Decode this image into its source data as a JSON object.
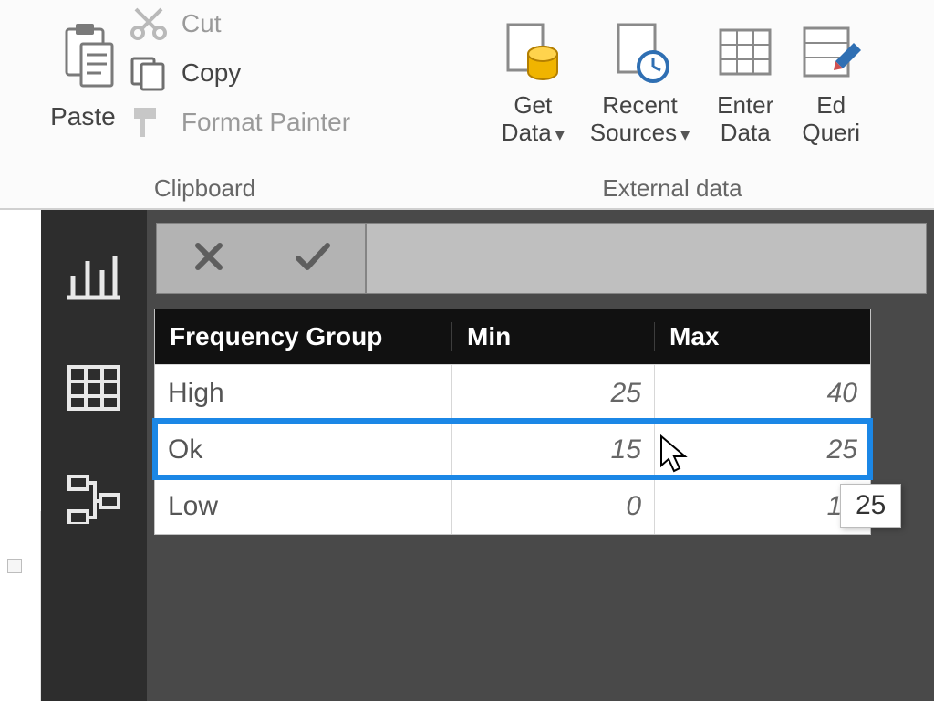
{
  "ribbon": {
    "paste_label": "Paste",
    "cut_label": "Cut",
    "copy_label": "Copy",
    "format_painter_label": "Format Painter",
    "clipboard_group_title": "Clipboard",
    "get_data_line1": "Get",
    "get_data_line2": "Data",
    "recent_sources_line1": "Recent",
    "recent_sources_line2": "Sources",
    "enter_data_line1": "Enter",
    "enter_data_line2": "Data",
    "edit_queries_line1": "Ed",
    "edit_queries_line2": "Queri",
    "external_data_group_title": "External data"
  },
  "table": {
    "headers": {
      "group": "Frequency Group",
      "min": "Min",
      "max": "Max"
    },
    "rows": [
      {
        "group": "High",
        "min": "25",
        "max": "40"
      },
      {
        "group": "Ok",
        "min": "15",
        "max": "25"
      },
      {
        "group": "Low",
        "min": "0",
        "max": "15"
      }
    ]
  },
  "tooltip": {
    "value": "25"
  }
}
